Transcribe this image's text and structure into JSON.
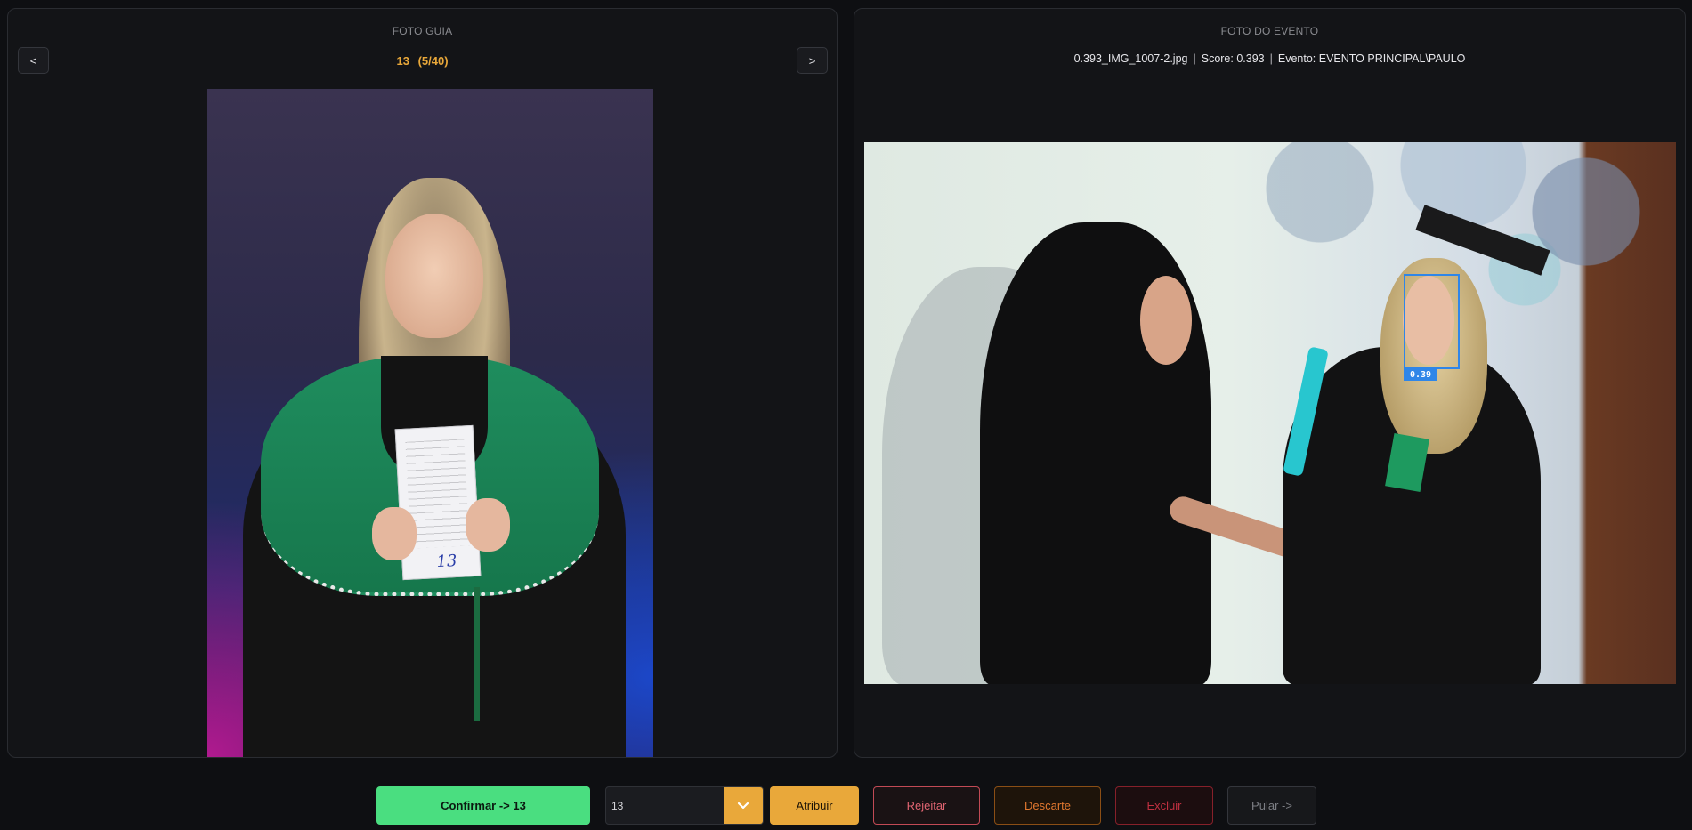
{
  "guide": {
    "title": "FOTO GUIA",
    "current_id": "13",
    "position": "(5/40)",
    "prev_label": "<",
    "next_label": ">",
    "sheet_number": "13"
  },
  "event": {
    "title": "FOTO DO EVENTO",
    "filename": "0.393_IMG_1007-2.jpg",
    "score_text": "Score: 0.393",
    "event_text": "Evento: EVENTO PRINCIPAL\\PAULO",
    "separator": "|",
    "face_score": "0.39"
  },
  "toolbar": {
    "confirm_label": "Confirmar -> 13",
    "target_value": "13",
    "assign_label": "Atribuir",
    "reject_label": "Rejeitar",
    "discard_label": "Descarte",
    "delete_label": "Excluir",
    "skip_label": "Pular  ->"
  },
  "colors": {
    "accent": "#e9a83a",
    "confirm": "#4ade80",
    "face_box": "#2f86e8",
    "reject": "#e06471",
    "discard": "#e0772f",
    "delete": "#c03040"
  },
  "icons": {
    "dropdown": "chevron-down-icon"
  }
}
